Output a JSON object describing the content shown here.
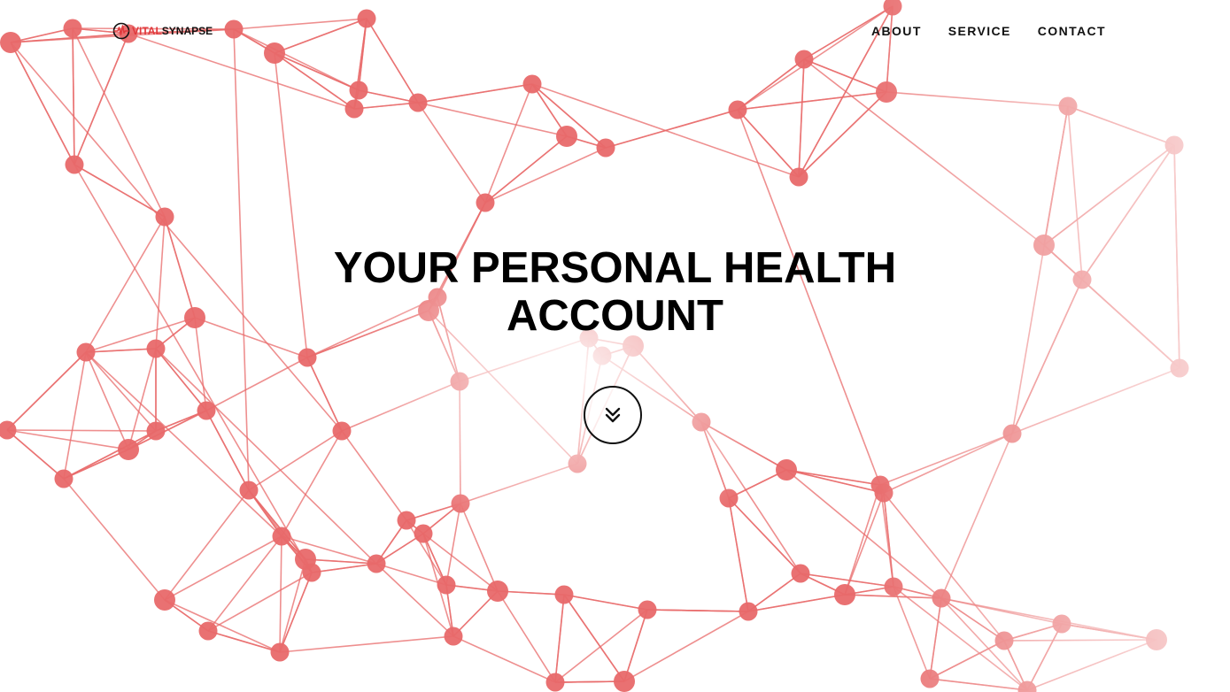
{
  "brand": {
    "name_part1": "VITAL",
    "name_part2": "SYNAPSE",
    "accent_color": "#e0393c",
    "icon": "heartbeat-pulse-icon"
  },
  "nav": {
    "items": [
      {
        "label": "ABOUT"
      },
      {
        "label": "SERVICE"
      },
      {
        "label": "CONTACT"
      }
    ]
  },
  "hero": {
    "title_line1": "YOUR PERSONAL HEALTH",
    "title_line2": "ACCOUNT",
    "scroll_icon": "double-chevron-down-icon"
  },
  "background": {
    "type": "network-graph",
    "node_color": "#e8696a",
    "edge_color": "#e8696a"
  }
}
